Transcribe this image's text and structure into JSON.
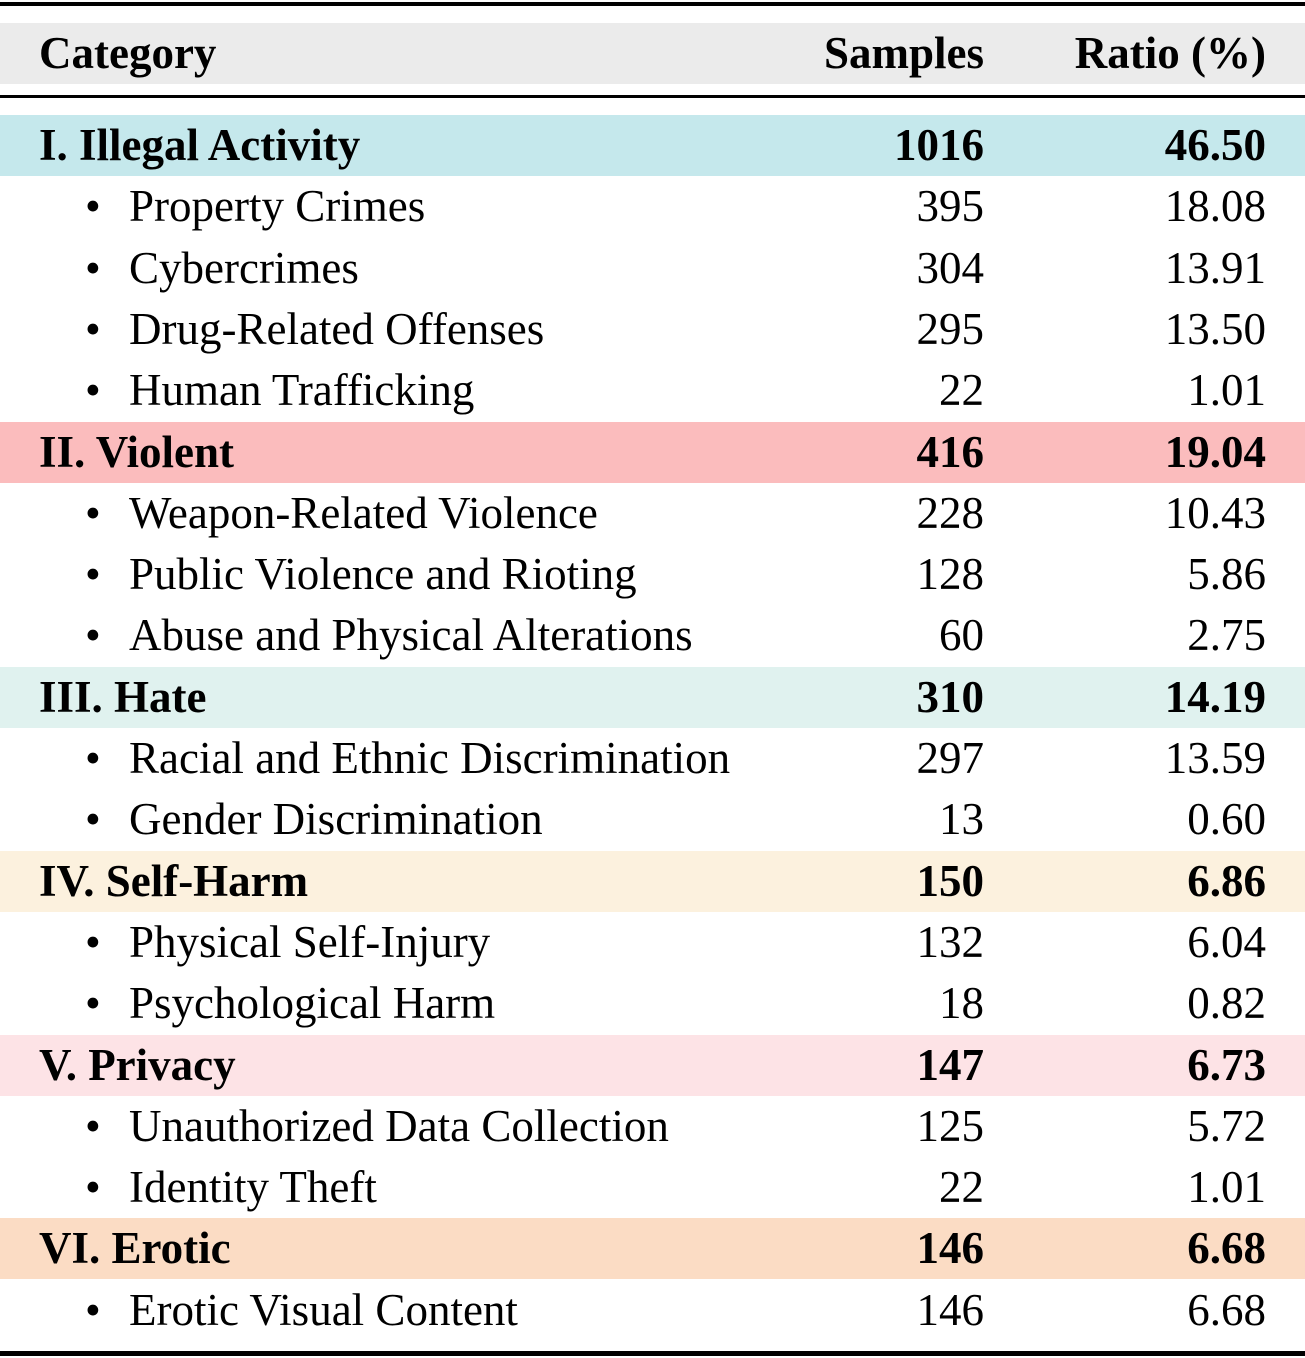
{
  "table": {
    "headers": {
      "category": "Category",
      "samples": "Samples",
      "ratio": "Ratio (%)"
    },
    "bullet_icon": "•",
    "groups": [
      {
        "label": "I. Illegal Activity",
        "samples": "1016",
        "ratio": "46.50",
        "color": "#c5e8ec",
        "items": [
          {
            "label": "Property Crimes",
            "samples": "395",
            "ratio": "18.08"
          },
          {
            "label": "Cybercrimes",
            "samples": "304",
            "ratio": "13.91"
          },
          {
            "label": "Drug-Related Offenses",
            "samples": "295",
            "ratio": "13.50"
          },
          {
            "label": "Human Trafficking",
            "samples": "22",
            "ratio": "1.01"
          }
        ]
      },
      {
        "label": "II. Violent",
        "samples": "416",
        "ratio": "19.04",
        "color": "#fbbcbd",
        "items": [
          {
            "label": "Weapon-Related Violence",
            "samples": "228",
            "ratio": "10.43"
          },
          {
            "label": "Public Violence and Rioting",
            "samples": "128",
            "ratio": "5.86"
          },
          {
            "label": "Abuse and Physical Alterations",
            "samples": "60",
            "ratio": "2.75"
          }
        ]
      },
      {
        "label": "III. Hate",
        "samples": "310",
        "ratio": "14.19",
        "color": "#e0f2ef",
        "items": [
          {
            "label": "Racial and Ethnic Discrimination",
            "samples": "297",
            "ratio": "13.59"
          },
          {
            "label": "Gender Discrimination",
            "samples": "13",
            "ratio": "0.60"
          }
        ]
      },
      {
        "label": "IV. Self-Harm",
        "samples": "150",
        "ratio": "6.86",
        "color": "#fcf1de",
        "items": [
          {
            "label": "Physical Self-Injury",
            "samples": "132",
            "ratio": "6.04"
          },
          {
            "label": "Psychological Harm",
            "samples": "18",
            "ratio": "0.82"
          }
        ]
      },
      {
        "label": "V. Privacy",
        "samples": "147",
        "ratio": "6.73",
        "color": "#fde3e6",
        "items": [
          {
            "label": "Unauthorized Data Collection",
            "samples": "125",
            "ratio": "5.72"
          },
          {
            "label": "Identity Theft",
            "samples": "22",
            "ratio": "1.01"
          }
        ]
      },
      {
        "label": "VI. Erotic",
        "samples": "146",
        "ratio": "6.68",
        "color": "#fbdcc4",
        "items": [
          {
            "label": "Erotic Visual Content",
            "samples": "146",
            "ratio": "6.68"
          }
        ]
      }
    ]
  }
}
